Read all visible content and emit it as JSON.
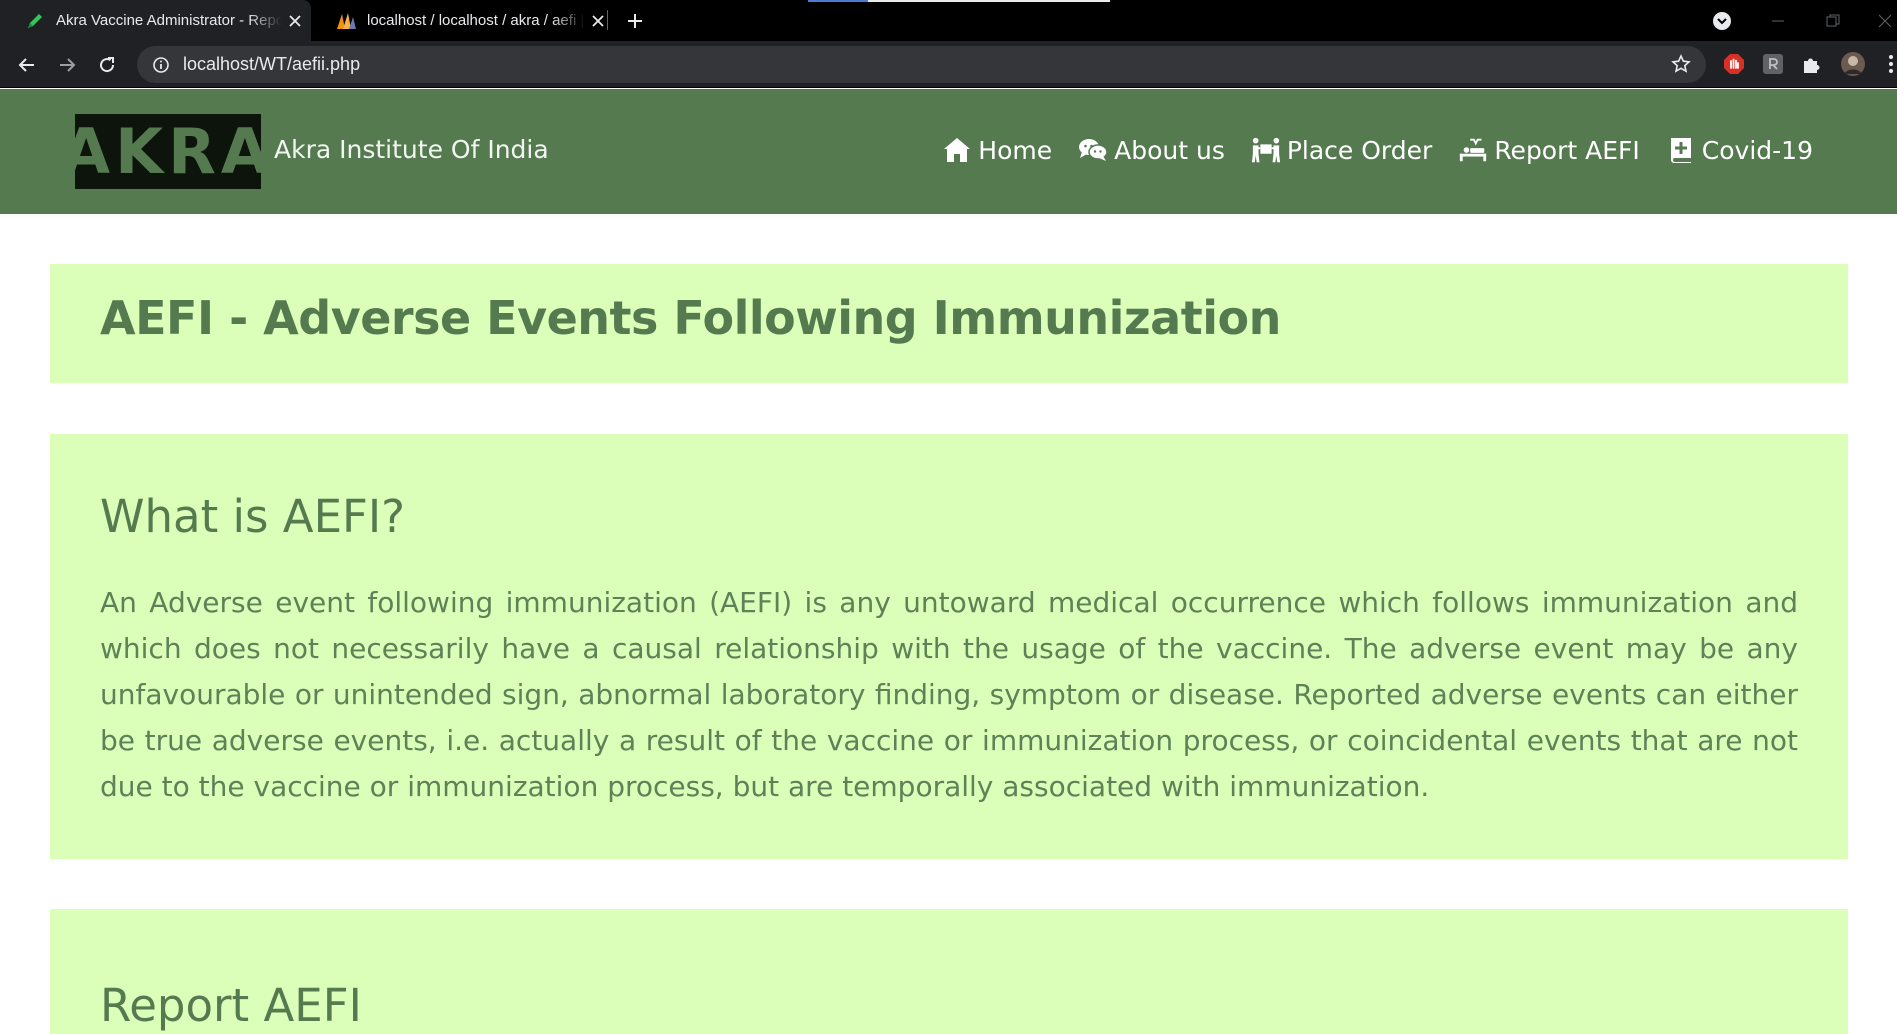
{
  "browser": {
    "tabs": [
      {
        "title": "Akra Vaccine Administrator - Report AEFI",
        "icon": "pen-icon",
        "active": true
      },
      {
        "title": "localhost / localhost / akra / aefi | phpMyAdmin",
        "icon": "phpmyadmin-icon",
        "active": false
      }
    ],
    "address": "localhost/WT/aefii.php"
  },
  "site": {
    "logo": "AKRA",
    "name": "Akra Institute Of India",
    "nav": [
      {
        "label": "Home",
        "icon": "home-icon"
      },
      {
        "label": "About us",
        "icon": "chat-icon"
      },
      {
        "label": "Place Order",
        "icon": "people-carry-icon"
      },
      {
        "label": "Report AEFI",
        "icon": "procedures-icon"
      },
      {
        "label": "Covid-19",
        "icon": "medical-book-icon"
      }
    ]
  },
  "main": {
    "page_title": "AEFI - Adverse Events Following Immunization",
    "what": {
      "heading": "What is AEFI?",
      "body": "An Adverse event following immunization (AEFI) is any untoward medical occurrence which follows immunization and which does not necessarily have a causal relationship with the usage of the vaccine. The adverse event may be any unfavourable or unintended sign, abnormal laboratory finding, symptom or disease. Reported adverse events can either be true adverse events, i.e. actually a result of the vaccine or immunization process, or coincidental events that are not due to the vaccine or immunization process, but are temporally associated with immunization."
    },
    "report": {
      "heading": "Report AEFI"
    }
  },
  "colors": {
    "header_bg": "#557a50",
    "panel_bg": "#dbffb8",
    "text_green": "#557a50",
    "logo_bg": "#0d140c"
  }
}
